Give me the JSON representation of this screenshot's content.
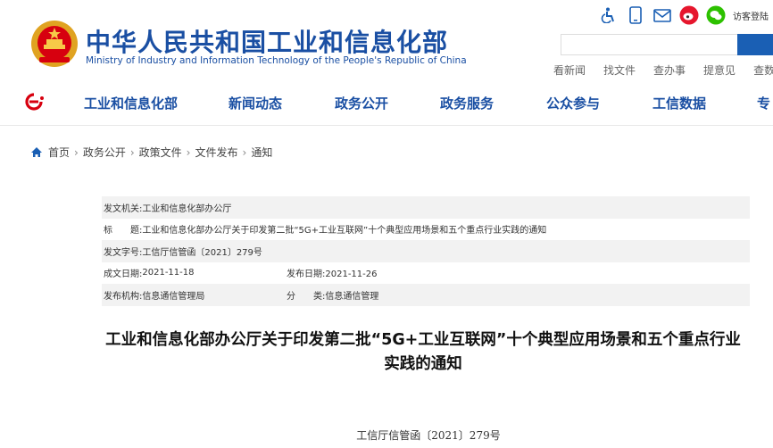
{
  "header": {
    "title_cn": "中华人民共和国工业和信息化部",
    "title_en": "Ministry of Industry and Information Technology of the People's Republic of China",
    "icons": [
      "accessibility-icon",
      "mobile-icon",
      "mail-icon",
      "weibo-icon",
      "wechat-icon"
    ],
    "visitor_label": "访客登陆",
    "search": {
      "placeholder": ""
    },
    "quick_links": [
      "看新闻",
      "找文件",
      "查办事",
      "提意见",
      "查数据"
    ]
  },
  "nav": {
    "items": [
      "工业和信息化部",
      "新闻动态",
      "政务公开",
      "政务服务",
      "公众参与",
      "工信数据",
      "专"
    ]
  },
  "breadcrumb": [
    "首页",
    "政务公开",
    "政策文件",
    "文件发布",
    "通知"
  ],
  "meta": {
    "issuer_label": "发文机关:",
    "issuer": "工业和信息化部办公厅",
    "subject_label": "标　　题:",
    "subject": "工业和信息化部办公厅关于印发第二批“5G+工业互联网”十个典型应用场景和五个重点行业实践的通知",
    "docno_label": "发文字号:",
    "docno": "工信厅信管函〔2021〕279号",
    "created_label": "成文日期:",
    "created": "2021-11-18",
    "published_label": "发布日期:",
    "published": "2021-11-26",
    "agency_label": "发布机构:",
    "agency": "信息通信管理局",
    "category_label": "分　　类:",
    "category": "信息通信管理"
  },
  "article": {
    "title": "工业和信息化部办公厅关于印发第二批“5G+工业互联网”十个典型应用场景和五个重点行业实践的通知",
    "doc_number": "工信厅信管函〔2021〕279号"
  },
  "colors": {
    "brand": "#1a4fa3",
    "red": "#d7000f",
    "shade": "#f2f2f2"
  }
}
